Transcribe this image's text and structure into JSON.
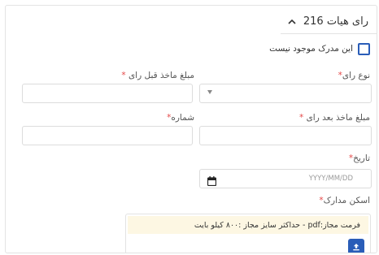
{
  "header": {
    "title": "رای هیات 216"
  },
  "document_missing": {
    "label": "این مدرک موجود نیست",
    "checked": false
  },
  "fields": {
    "vote_type": {
      "label": "نوع رای",
      "required_mark": "*"
    },
    "amount_before": {
      "label": "مبلغ ماخذ قبل رای",
      "required_mark": "*"
    },
    "amount_after": {
      "label": "مبلغ ماخذ بعد رای",
      "required_mark": "*"
    },
    "number": {
      "label": "شماره",
      "required_mark": "*"
    },
    "date": {
      "label": "تاریخ",
      "required_mark": "*",
      "placeholder": "YYYY/MM/DD"
    },
    "scan": {
      "label": "اسکن مدارک",
      "required_mark": "*"
    }
  },
  "upload": {
    "note": "فرمت مجاز:pdf - حداکثر سایز مجاز :۸۰۰ کیلو بایت"
  },
  "colors": {
    "accent": "#2a5db8",
    "required": "#e54848",
    "note_background": "#fdf7e3"
  }
}
